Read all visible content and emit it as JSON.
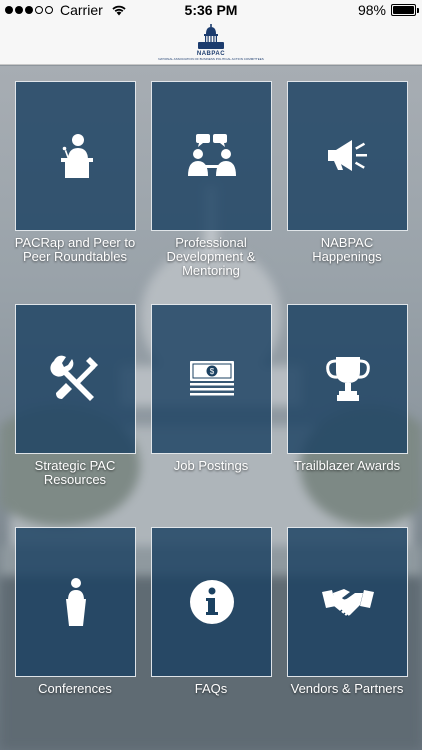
{
  "status_bar": {
    "carrier": "Carrier",
    "time": "5:36 PM",
    "battery": "98%",
    "battery_level": 0.98
  },
  "header": {
    "logo_name": "NABPAC",
    "logo_sub": "NATIONAL ASSOCIATION OF BUSINESS POLITICAL ACTION COMMITTEES"
  },
  "menu": {
    "items": [
      {
        "label": "PACRap and Peer to Peer Roundtables",
        "icon": "presenter-podium-icon"
      },
      {
        "label": "Professional Development & Mentoring",
        "icon": "people-talking-icon"
      },
      {
        "label": "NABPAC Happenings",
        "icon": "megaphone-icon"
      },
      {
        "label": "Strategic PAC Resources",
        "icon": "tools-icon"
      },
      {
        "label": "Job Postings",
        "icon": "money-stack-icon"
      },
      {
        "label": "Trailblazer Awards",
        "icon": "trophy-icon"
      },
      {
        "label": "Conferences",
        "icon": "lectern-icon"
      },
      {
        "label": "FAQs",
        "icon": "info-icon"
      },
      {
        "label": "Vendors & Partners",
        "icon": "handshake-icon"
      }
    ]
  },
  "colors": {
    "tile": "#1b4161",
    "tile_border": "#ffffff",
    "header_bg": "#f7f7f7",
    "logo": "#1c3c6e"
  }
}
